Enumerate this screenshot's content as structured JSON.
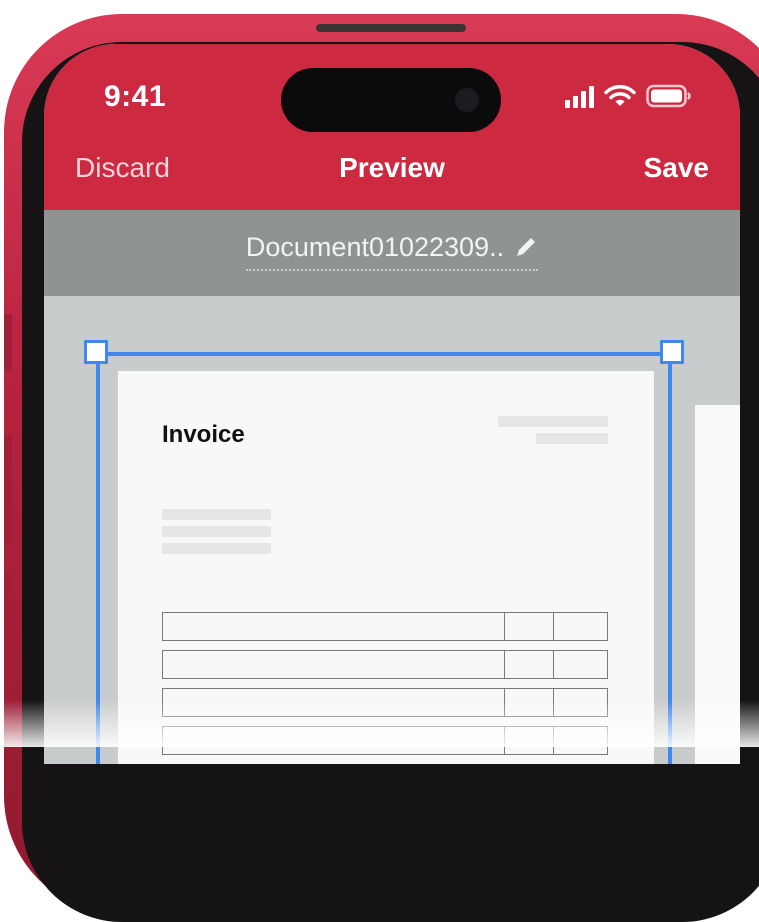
{
  "status_bar": {
    "time": "9:41",
    "icons": [
      "cellular-signal-icon",
      "wifi-icon",
      "battery-icon"
    ]
  },
  "nav": {
    "left_label": "Discard",
    "title": "Preview",
    "right_label": "Save"
  },
  "document": {
    "name": "Document01022309..",
    "edit_icon": "pencil-icon"
  },
  "invoice": {
    "title": "Invoice",
    "table_rows": 4
  },
  "colors": {
    "header": "#cd2940",
    "crop_frame": "#3e88f0",
    "doc_bar": "#8f9394"
  }
}
